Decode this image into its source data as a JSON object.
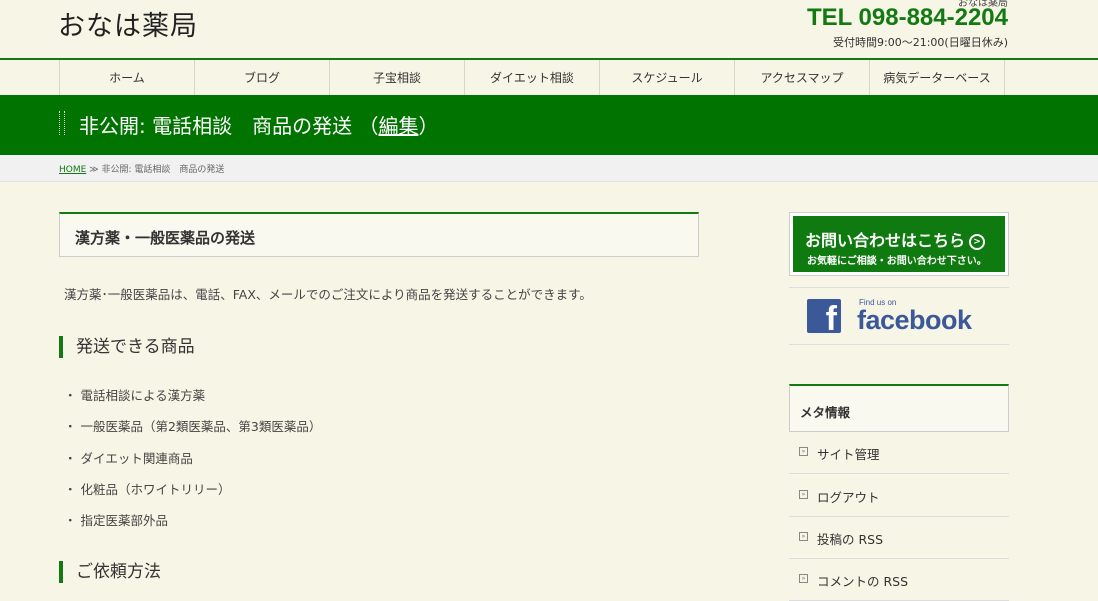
{
  "header": {
    "logo": "おなは薬局",
    "site_name_small": "おなは薬局",
    "tel": "TEL 098-884-2204",
    "hours": "受付時間9:00〜21:00(日曜日休み)"
  },
  "nav": [
    {
      "label": "ホーム"
    },
    {
      "label": "ブログ"
    },
    {
      "label": "子宝相談"
    },
    {
      "label": "ダイエット相談"
    },
    {
      "label": "スケジュール"
    },
    {
      "label": "アクセスマップ"
    },
    {
      "label": "病気データーベース"
    }
  ],
  "title_bar": {
    "title": "非公開: 電話相談　商品の発送",
    "edit_open": "（",
    "edit_link": "編集",
    "edit_close": "）"
  },
  "breadcrumb": {
    "home": "HOME",
    "separator": "≫",
    "current": "非公開: 電話相談　商品の発送"
  },
  "main": {
    "section_title": "漢方薬・一般医薬品の発送",
    "intro": "漢方薬･一般医薬品は、電話、FAX、メールでのご注文により商品を発送することができます。",
    "h3_products": "発送できる商品",
    "products": [
      "・ 電話相談による漢方薬",
      "・ 一般医薬品（第2類医薬品、第3類医薬品）",
      "・ ダイエット関連商品",
      "・ 化粧品（ホワイトリリー）",
      "・ 指定医薬部外品"
    ],
    "h3_method": "ご依頼方法"
  },
  "sidebar": {
    "contact_main": "お問い合わせはこちら",
    "contact_arrow": ">",
    "contact_sub": "お気軽にご相談・お問い合わせ下さい。",
    "fb_letter": "f",
    "fb_find": "Find us on",
    "fb_word": "facebook",
    "meta_title": "メタ情報",
    "meta_items": [
      {
        "label": "サイト管理"
      },
      {
        "label": "ログアウト"
      },
      {
        "label": "投稿の RSS"
      },
      {
        "label": "コメントの RSS"
      }
    ],
    "meta_marker": "»"
  },
  "colors": {
    "accent_green": "#007300",
    "background": "#f7f5e6",
    "facebook_blue": "#3b5998"
  }
}
